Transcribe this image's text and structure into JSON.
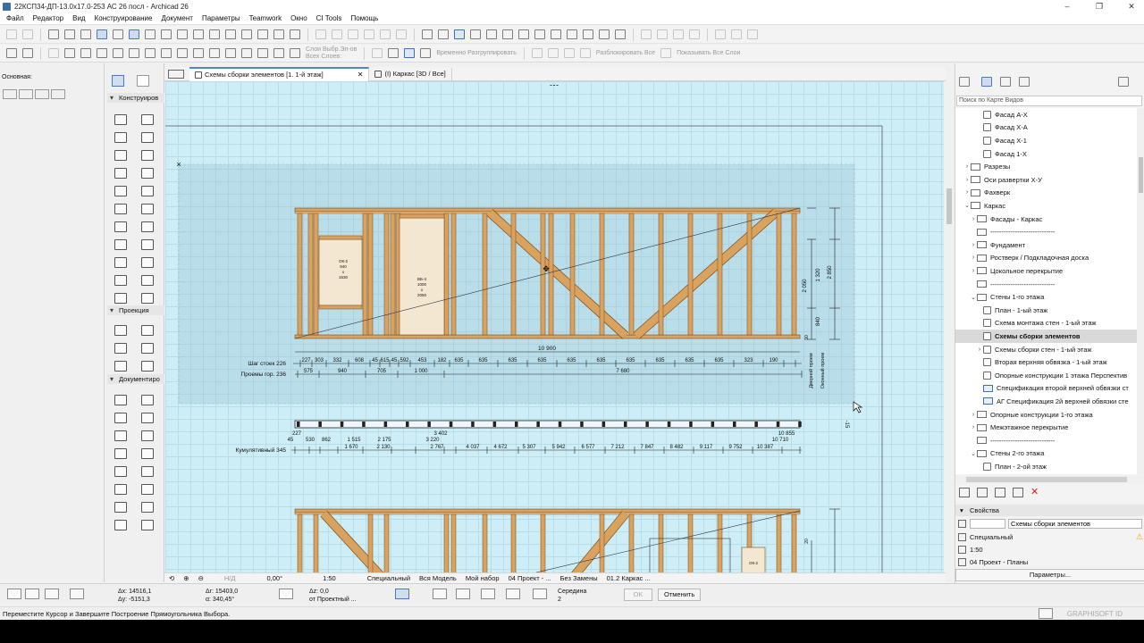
{
  "window": {
    "title": "22КСП34-ДП-13.0х17.0-253 АС 26 посл - Archicad 26"
  },
  "menu": [
    "Файл",
    "Редактор",
    "Вид",
    "Конструирование",
    "Документ",
    "Параметры",
    "Teamwork",
    "Окно",
    "CI Tools",
    "Помощь"
  ],
  "toolbar2": {
    "layers_label1": "Слои Выбр.Эл-ов",
    "layers_label2": "Всех Слоев:",
    "ungroup": "Временно Разгруппировать",
    "unlock_all": "Разблокировать Все",
    "show_all": "Показывать Все Слои"
  },
  "left_panel": {
    "label": "Основная:"
  },
  "toolbox": {
    "sections": [
      "Конструиров",
      "Проекция",
      "Документиро"
    ]
  },
  "tabs": [
    {
      "label": "Схемы сборки элементов [1. 1-й этаж]",
      "active": true
    },
    {
      "label": "(I) Каркас [3D / Все]",
      "active": false
    }
  ],
  "drawing": {
    "labels": {
      "window1": [
        "ОК-2",
        "940",
        "х",
        "1530"
      ],
      "door1": [
        "ВБ-4",
        "1000",
        "х",
        "2050"
      ],
      "total_top": "10 900",
      "row1_name": "Шаг стоек 226",
      "row2_name": "Проемы гор. 236",
      "row3_name": "Кумулятивный 345",
      "row1_values": [
        "227",
        "303",
        "332",
        "608",
        "45",
        "615",
        "45",
        "592",
        "453",
        "182",
        "635",
        "635",
        "635",
        "635",
        "635",
        "635",
        "635",
        "635",
        "635",
        "635",
        "323",
        "190"
      ],
      "row2_values": [
        "575",
        "940",
        "705",
        "1 000",
        "7 680"
      ],
      "dims_right": [
        "2 050",
        "1 320",
        "840",
        "2 850",
        "90"
      ],
      "vert_labels": [
        "Дверной проем",
        "Оконный проем"
      ],
      "row3_top": [
        "227",
        "45",
        "530",
        "862",
        "1 515",
        "1 670",
        "2 175",
        "2 130",
        "3 402",
        "3 220",
        "10 855",
        "10 710"
      ],
      "row3_values": [
        "2 767",
        "4 037",
        "4 672",
        "5 307",
        "5 942",
        "6 577",
        "7 212",
        "7 847",
        "8 482",
        "9 117",
        "9 752",
        "10 387"
      ],
      "misc": "-15",
      "bottom_window": [
        "ОК-2"
      ],
      "bottom_dim": "20"
    }
  },
  "status_nav": {
    "angle": "0,00°",
    "scale": "1:50",
    "layer_combo": "Специальный",
    "model": "Вся Модель",
    "pen_set": "Мой набор",
    "project": "04 Проект - ...",
    "renov": "Без Замены",
    "view": "01.2 Каркас ...",
    "nd": "Н/Д"
  },
  "info_bar": {
    "dx": "Δx: 14516,1",
    "dy": "Δy: -5151,3",
    "dr": "Δr: 15403,0",
    "da": "α: 340,45°",
    "dz": "Δz: 0,0",
    "from": "от Проектный ...",
    "mid": "Середина",
    "mid_n": "2",
    "ok": "OK",
    "cancel": "Отменить"
  },
  "message": "Переместите Курсор и Завершите Построение Прямоугольника Выбора.",
  "brand": "GRAPHISOFT ID",
  "navigator": {
    "search_placeholder": "Поиск по Карте Видов",
    "tree": [
      {
        "label": "Фасад А-Х",
        "indent": 3,
        "arrow": "",
        "type": "doc"
      },
      {
        "label": "Фасад Х-А",
        "indent": 3,
        "arrow": "",
        "type": "doc"
      },
      {
        "label": "Фасад Х-1",
        "indent": 3,
        "arrow": "",
        "type": "doc"
      },
      {
        "label": "Фасад 1-Х",
        "indent": 3,
        "arrow": "",
        "type": "doc"
      },
      {
        "label": "Разрезы",
        "indent": 1,
        "arrow": "›",
        "type": "folder"
      },
      {
        "label": "Оси развертки Х-У",
        "indent": 1,
        "arrow": "›",
        "type": "folder"
      },
      {
        "label": "Фахверк",
        "indent": 1,
        "arrow": "›",
        "type": "folder"
      },
      {
        "label": "Каркас",
        "indent": 1,
        "arrow": "⌄",
        "type": "folder"
      },
      {
        "label": "Фасады - Каркас",
        "indent": 2,
        "arrow": "›",
        "type": "folder"
      },
      {
        "label": "-----------------------------",
        "indent": 2,
        "arrow": "",
        "type": "folder"
      },
      {
        "label": "Фундамент",
        "indent": 2,
        "arrow": "›",
        "type": "folder"
      },
      {
        "label": "Ростверк / Подкладочная доска",
        "indent": 2,
        "arrow": "›",
        "type": "folder"
      },
      {
        "label": "Цокольное перекрытие",
        "indent": 2,
        "arrow": "›",
        "type": "folder"
      },
      {
        "label": "-----------------------------",
        "indent": 2,
        "arrow": "",
        "type": "folder"
      },
      {
        "label": "Стены 1-го этажа",
        "indent": 2,
        "arrow": "⌄",
        "type": "folder"
      },
      {
        "label": "План - 1-ый этаж",
        "indent": 3,
        "arrow": "",
        "type": "doc"
      },
      {
        "label": "Схема монтажа стен - 1-ый этаж",
        "indent": 3,
        "arrow": "",
        "type": "doc"
      },
      {
        "label": "Схемы сборки элементов",
        "indent": 3,
        "arrow": "",
        "type": "doc",
        "selected": true
      },
      {
        "label": "Схемы сборки стен - 1-ый этаж",
        "indent": 3,
        "arrow": "›",
        "type": "doc"
      },
      {
        "label": "Вторая верхняя обвязка - 1-ый этаж",
        "indent": 3,
        "arrow": "",
        "type": "doc"
      },
      {
        "label": "Опорные конструкции 1 этажа Перспектив",
        "indent": 3,
        "arrow": "",
        "type": "doc"
      },
      {
        "label": "Спецификация второй верхней обвязки ст",
        "indent": 3,
        "arrow": "",
        "type": "sched"
      },
      {
        "label": "АГ Спецификация 2й верхней обвязки сте",
        "indent": 3,
        "arrow": "",
        "type": "sched"
      },
      {
        "label": "Опорные конструкции 1-го этажа",
        "indent": 2,
        "arrow": "›",
        "type": "folder"
      },
      {
        "label": "Межэтажное перекрытие",
        "indent": 2,
        "arrow": "›",
        "type": "folder"
      },
      {
        "label": "-----------------------------",
        "indent": 2,
        "arrow": "",
        "type": "folder"
      },
      {
        "label": "Стены 2-го этажа",
        "indent": 2,
        "arrow": "⌄",
        "type": "folder"
      },
      {
        "label": "План - 2-ой этаж",
        "indent": 3,
        "arrow": "",
        "type": "doc"
      }
    ]
  },
  "properties": {
    "header": "Свойства",
    "name_value": "Схемы сборки элементов",
    "layer_combo": "Специальный",
    "scale": "1:50",
    "pen": "04 Проект - Планы",
    "params_button": "Параметры..."
  },
  "colors": {
    "canvas_bg": "#cdeef7",
    "timber": "#d9a25f",
    "timber_edge": "#7a4d1c",
    "accent": "#4f86c6"
  }
}
